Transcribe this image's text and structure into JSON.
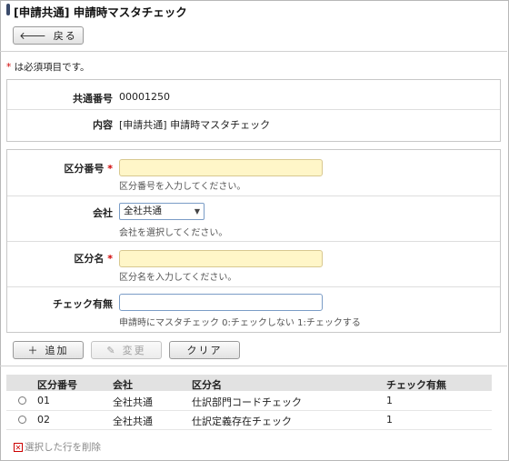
{
  "header": {
    "title": "[申請共通] 申請時マスタチェック"
  },
  "toolbar": {
    "back_label": "戻る",
    "back_icon": "arrow-left-icon"
  },
  "note": {
    "required_mark": "*",
    "text": " は必須項目です。"
  },
  "info": {
    "id_label": "共通番号",
    "id_value": "00001250",
    "content_label": "内容",
    "content_value": "[申請共通] 申請時マスタチェック"
  },
  "form": {
    "kubun_no": {
      "label": "区分番号",
      "required": "*",
      "value": "",
      "hint": "区分番号を入力してください。"
    },
    "company": {
      "label": "会社",
      "value": "全社共通",
      "hint": "会社を選択してください。"
    },
    "kubun_name": {
      "label": "区分名",
      "required": "*",
      "value": "",
      "hint": "区分名を入力してください。"
    },
    "check": {
      "label": "チェック有無",
      "value": "",
      "hint": "申請時にマスタチェック 0:チェックしない 1:チェックする"
    }
  },
  "actions": {
    "add_label": "追加",
    "change_label": "変更",
    "clear_label": "クリア"
  },
  "list": {
    "headers": [
      "区分番号",
      "会社",
      "区分名",
      "チェック有無"
    ],
    "rows": [
      [
        "01",
        "全社共通",
        "仕訳部門コードチェック",
        "1"
      ],
      [
        "02",
        "全社共通",
        "仕訳定義存在チェック",
        "1"
      ]
    ]
  },
  "footer": {
    "delete_label": "選択した行を削除"
  },
  "colors": {
    "required": "#d00000",
    "required_input_bg": "#fff6c8",
    "header_row_bg": "#e2e2e2"
  }
}
